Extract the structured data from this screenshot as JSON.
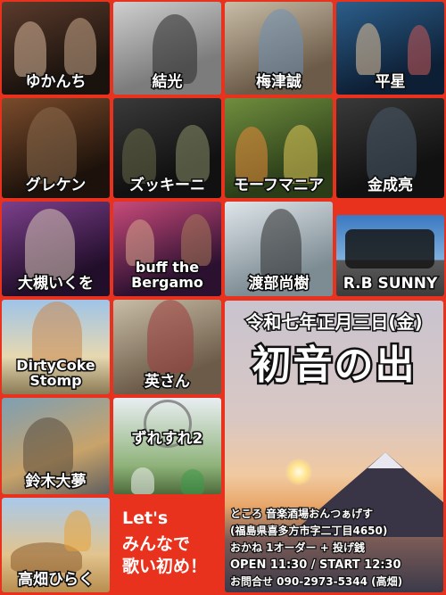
{
  "performers": [
    {
      "name": "ゆかんち"
    },
    {
      "name": "結光"
    },
    {
      "name": "梅津誠"
    },
    {
      "name": "平星"
    },
    {
      "name": "グレケン"
    },
    {
      "name": "ズッキーニ"
    },
    {
      "name": "モーフマニア"
    },
    {
      "name": "金成亮"
    },
    {
      "name": "大槻いくを"
    },
    {
      "name": "buff the Bergamo"
    },
    {
      "name": "渡部尚樹"
    },
    {
      "name": "R.B SUNNY"
    },
    {
      "name": "DirtyCoke Stomp"
    },
    {
      "name": "英さん"
    },
    {
      "name": "鈴木大夢"
    },
    {
      "name": "ずれすれ2"
    },
    {
      "name": "高畑ひらく"
    }
  ],
  "slogan": {
    "line1": "Let's",
    "line2": "みんなで",
    "line3": "歌い初め！"
  },
  "event": {
    "date": "令和七年正月三日(金)",
    "title": "初音の出",
    "venue": "ところ 音楽酒場おんつぁげす",
    "address": "(福島県喜多方市字二丁目4650)",
    "price": "おかね 1オーダー + 投げ銭",
    "time": "OPEN 11:30 / START 12:30",
    "contact": "お問合せ 090-2973-5344 (高畑)"
  }
}
